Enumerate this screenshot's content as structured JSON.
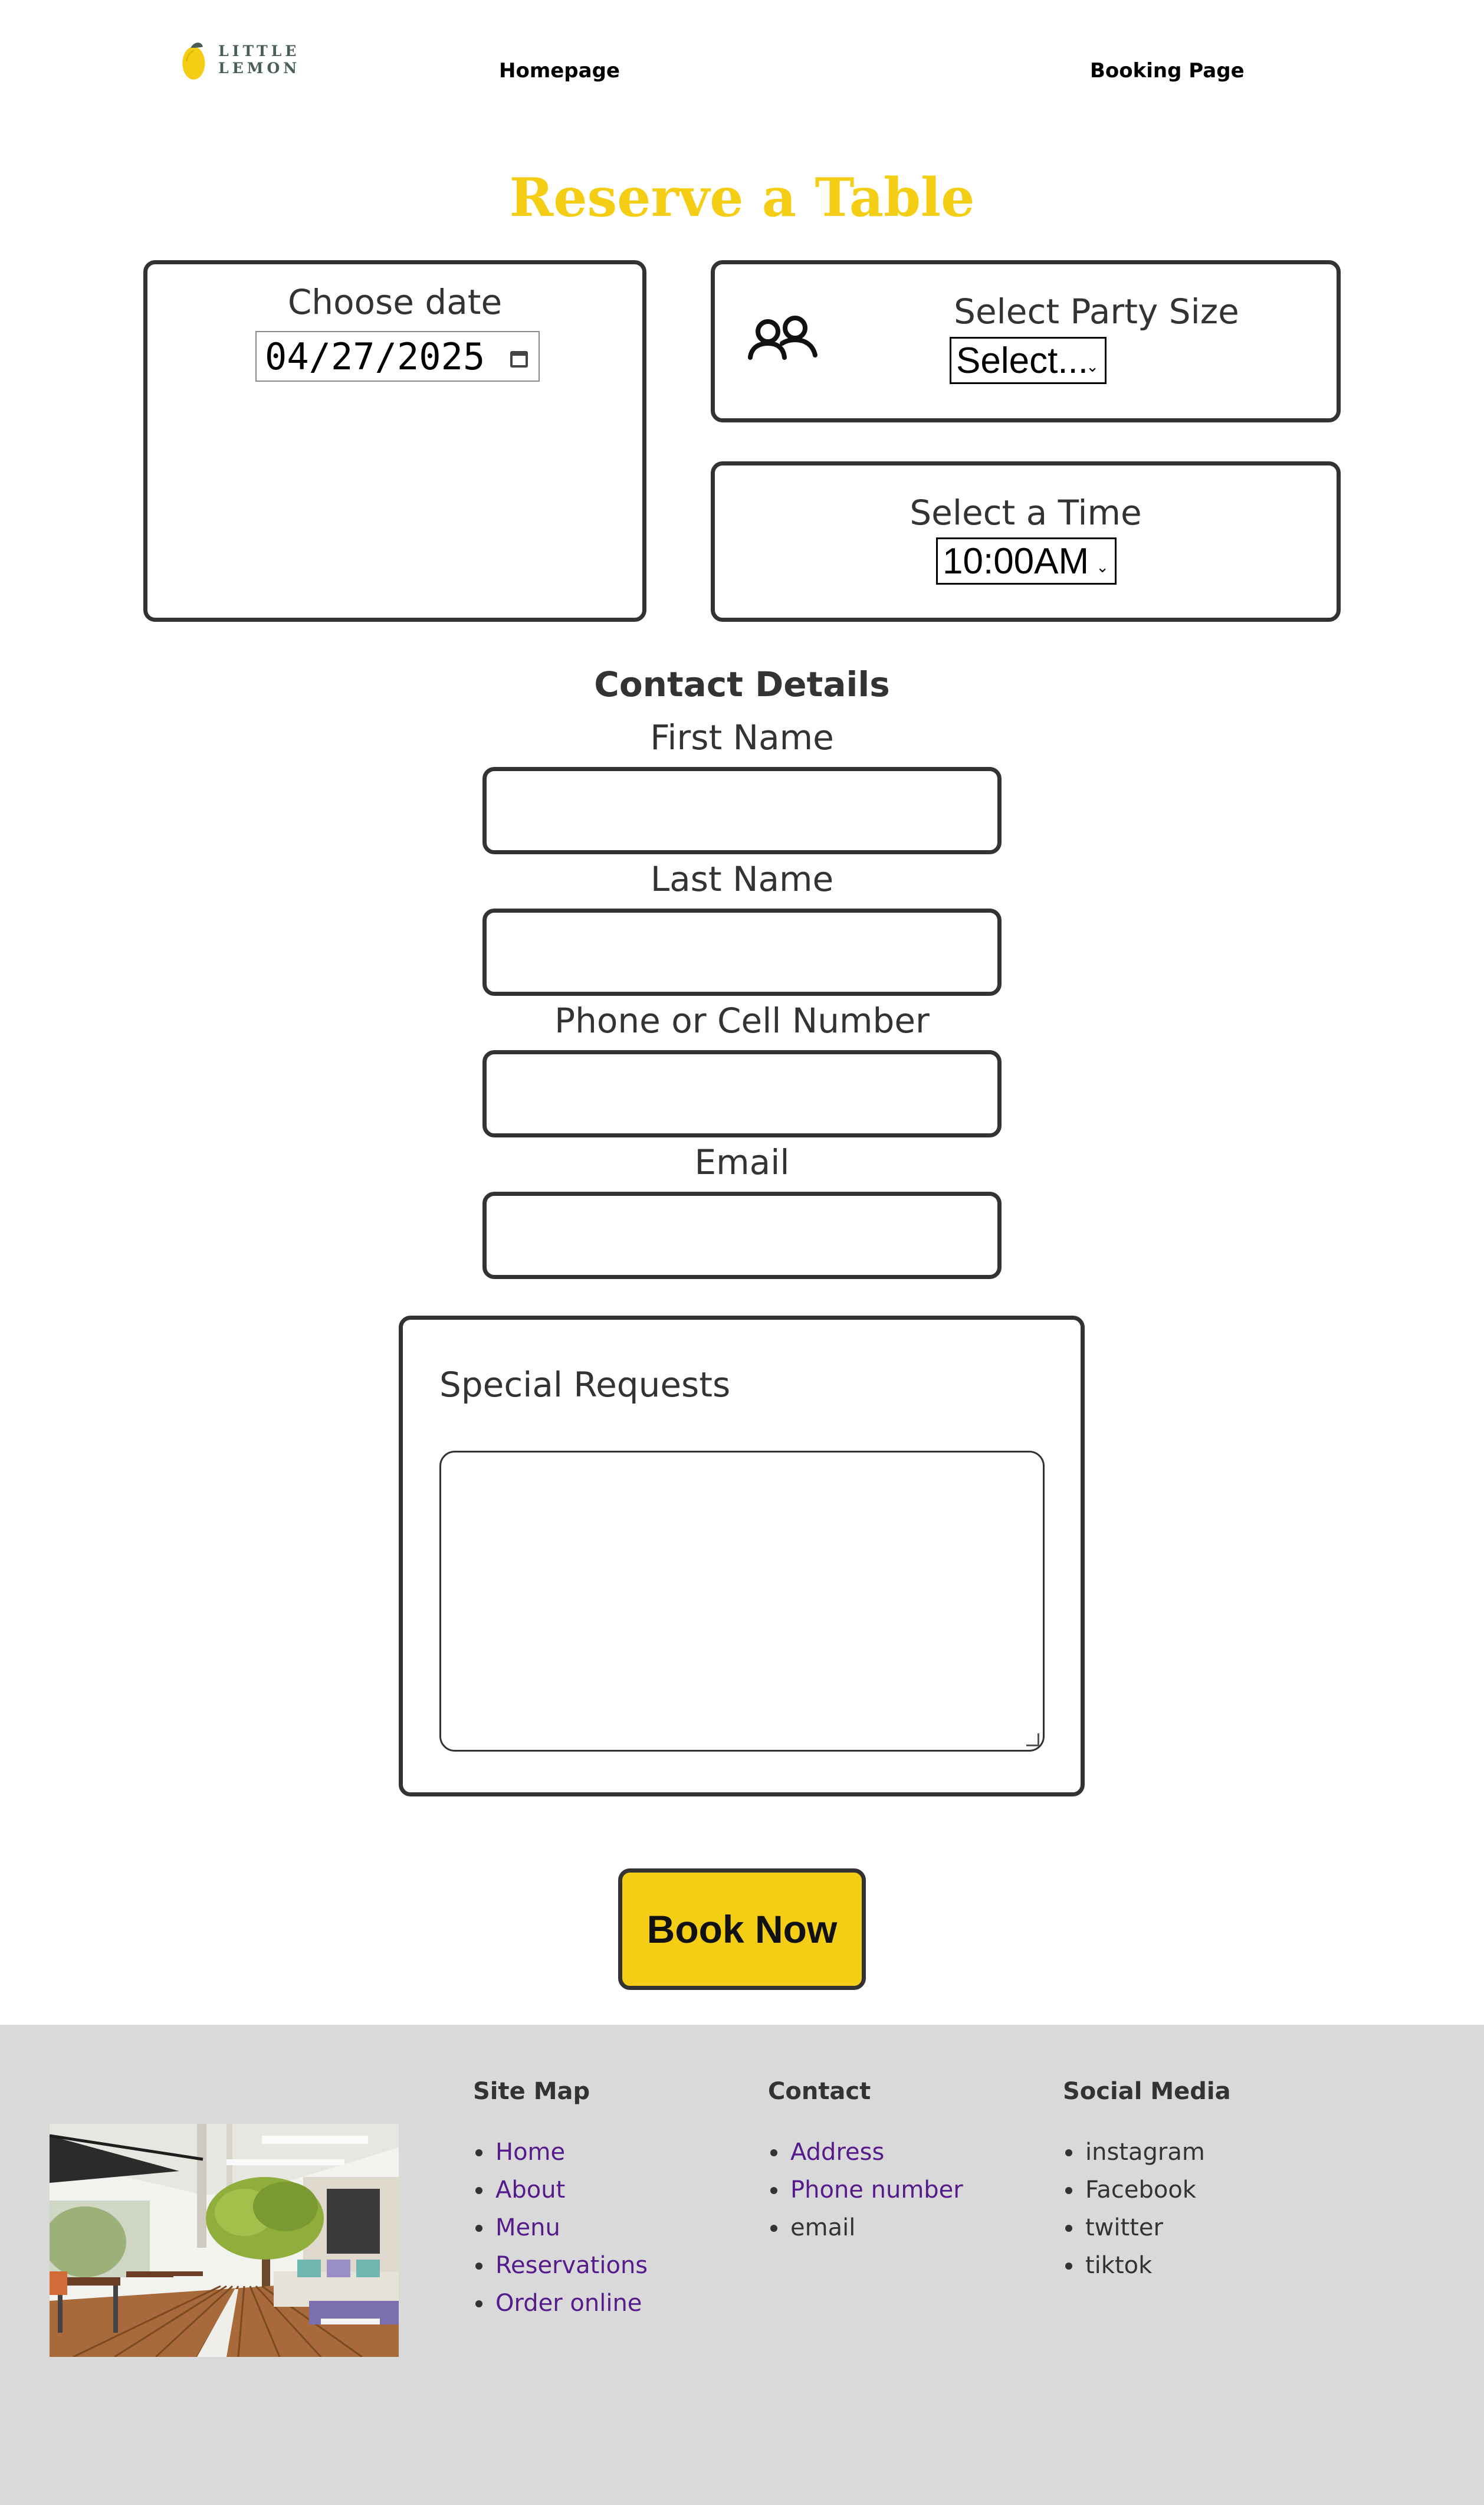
{
  "header": {
    "logo_text": "LITTLE LEMON",
    "nav": [
      {
        "label": "Homepage"
      },
      {
        "label": "Booking Page"
      }
    ]
  },
  "page_title": "Reserve a Table",
  "reservation": {
    "date": {
      "label": "Choose date",
      "value": "04/27/2025"
    },
    "party_size": {
      "label": "Select Party Size",
      "value": "Select..."
    },
    "time": {
      "label": "Select a Time",
      "value": "10:00AM"
    }
  },
  "contact": {
    "title": "Contact Details",
    "fields": [
      {
        "label": "First Name",
        "value": ""
      },
      {
        "label": "Last Name",
        "value": ""
      },
      {
        "label": "Phone or Cell Number",
        "value": ""
      },
      {
        "label": "Email",
        "value": ""
      }
    ]
  },
  "special_requests": {
    "label": "Special Requests",
    "value": ""
  },
  "book_now_label": "Book Now",
  "footer": {
    "sitemap": {
      "title": "Site Map",
      "items": [
        "Home",
        "About",
        "Menu",
        "Reservations",
        "Order online"
      ]
    },
    "contact": {
      "title": "Contact",
      "links": [
        "Address",
        "Phone number"
      ],
      "plain": [
        "email"
      ]
    },
    "social": {
      "title": "Social Media",
      "items": [
        "instagram",
        "Facebook",
        "twitter",
        "tiktok"
      ]
    }
  },
  "colors": {
    "brand_yellow": "#f4ce14",
    "brand_green": "#495e57",
    "border": "#333333",
    "footer_bg": "#d9d9d9",
    "link": "#551a8b"
  }
}
